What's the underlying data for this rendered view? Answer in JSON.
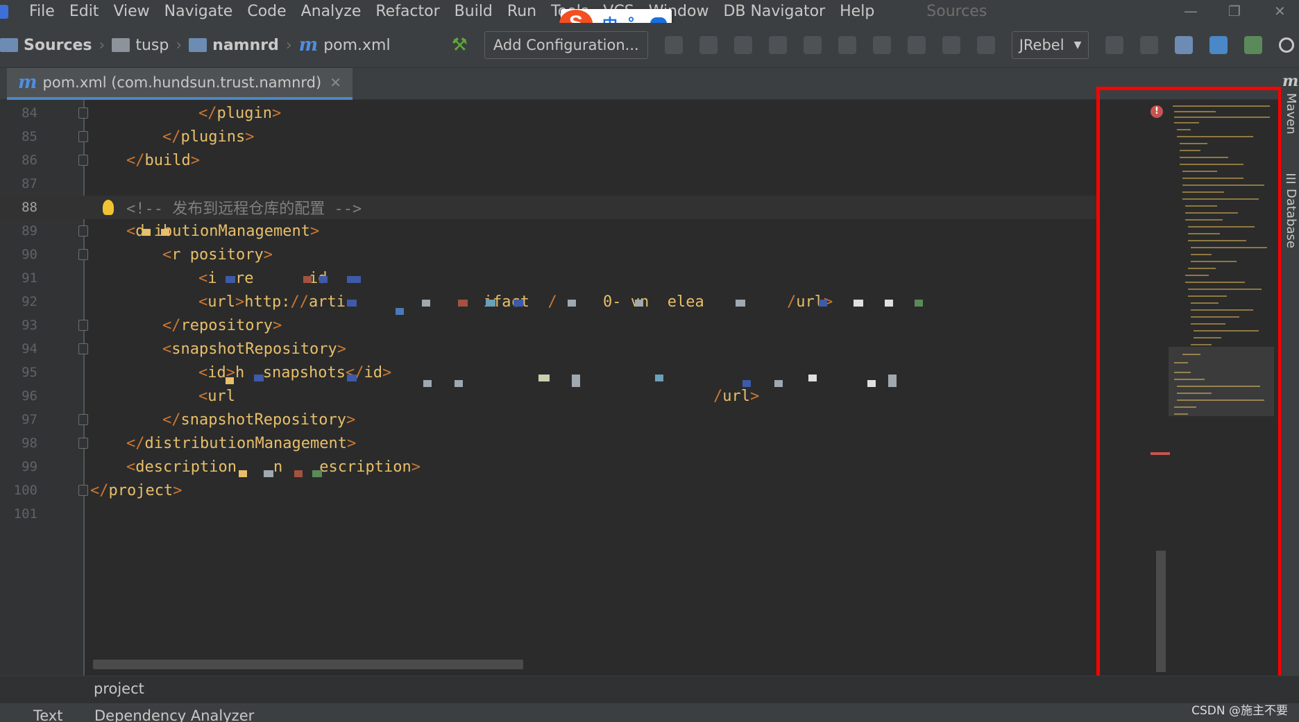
{
  "menu": {
    "items": [
      "File",
      "Edit",
      "View",
      "Navigate",
      "Code",
      "Analyze",
      "Refactor",
      "Build",
      "Run",
      "Tools",
      "VCS",
      "Window",
      "DB Navigator",
      "Help"
    ],
    "title": "Sources"
  },
  "ime": {
    "logo": "S",
    "mode": "中",
    "punct": "°,"
  },
  "breadcrumb": {
    "items": [
      "Sources",
      "tusp",
      "namnrd",
      "pom.xml"
    ]
  },
  "toolbar": {
    "add_configuration": "Add Configuration...",
    "jrebel": "JRebel"
  },
  "tab": {
    "label": "pom.xml (com.hundsun.trust.namnrd)"
  },
  "editor": {
    "lines": [
      {
        "number": "84",
        "text": "</plugin>"
      },
      {
        "number": "85",
        "text": "</plugins>"
      },
      {
        "number": "86",
        "text": "</build>"
      },
      {
        "number": "87",
        "text": ""
      },
      {
        "number": "88",
        "text": "<!-- 发布到远程仓库的配置 -->"
      },
      {
        "number": "89",
        "text": "<d ibutionManagement>"
      },
      {
        "number": "90",
        "text": "<r pository>"
      },
      {
        "number": "91",
        "text": "<i  re      id"
      },
      {
        "number": "92",
        "text": "<url>http://arti               ifact  / -   0- vn  elea         /url>"
      },
      {
        "number": "93",
        "text": "</repository>"
      },
      {
        "number": "94",
        "text": "<snapshotRepository>"
      },
      {
        "number": "95",
        "text": "<id>h  snapshots</id>"
      },
      {
        "number": "96",
        "text": "<url                                                    /url>"
      },
      {
        "number": "97",
        "text": "</snapshotRepository>"
      },
      {
        "number": "98",
        "text": "</distributionManagement>"
      },
      {
        "number": "99",
        "text": "<description    n    escription>"
      },
      {
        "number": "100",
        "text": "</project>"
      },
      {
        "number": "101",
        "text": ""
      }
    ]
  },
  "footer": {
    "path": "project",
    "tab_text": "Text",
    "tab_dependency": "Dependency Analyzer"
  },
  "rightbar": {
    "maven": "Maven",
    "database": "Database"
  },
  "watermark": "CSDN @施主不要",
  "colors": {
    "highlight_box": "#ff0000",
    "tag": "#e8bf6a",
    "bracket": "#cc7832",
    "comment": "#808080"
  }
}
